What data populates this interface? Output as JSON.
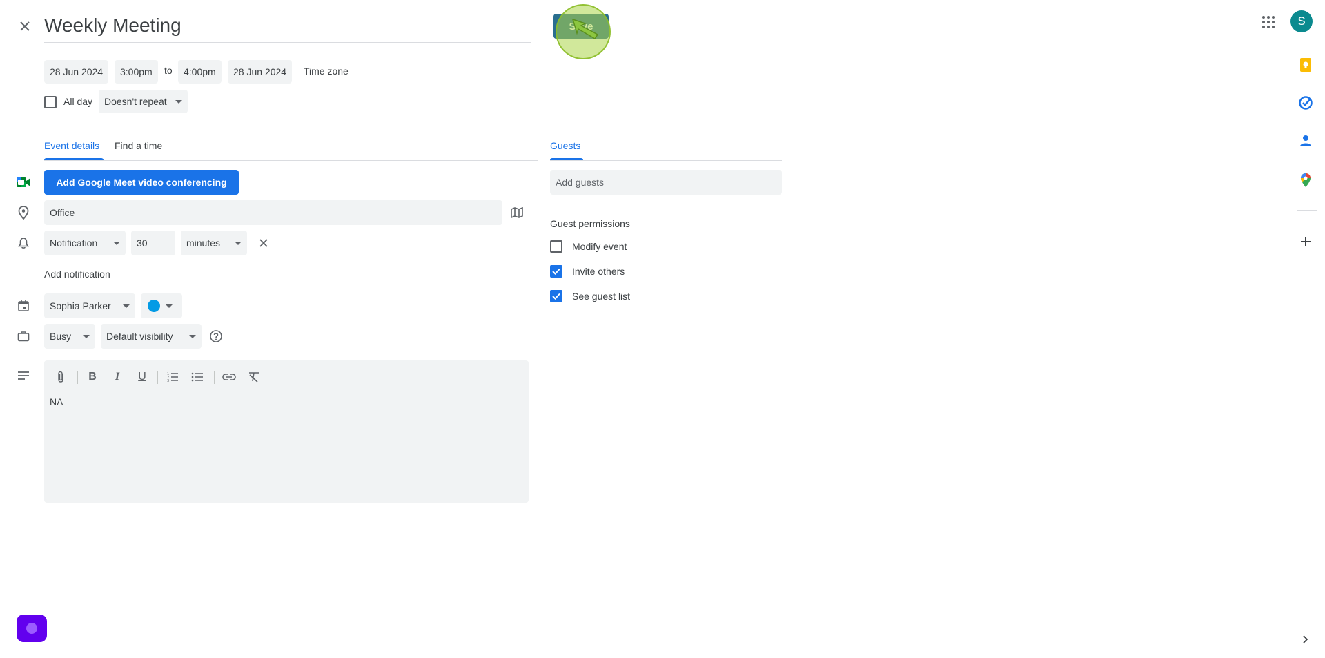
{
  "header": {
    "title_value": "Weekly Meeting",
    "save_label": "Save",
    "avatar_initial": "S"
  },
  "datetime": {
    "start_date": "28 Jun 2024",
    "start_time": "3:00pm",
    "to_label": "to",
    "end_time": "4:00pm",
    "end_date": "28 Jun 2024",
    "timezone_label": "Time zone",
    "all_day_label": "All day",
    "repeat_value": "Doesn't repeat"
  },
  "tabs": {
    "event_details": "Event details",
    "find_a_time": "Find a time",
    "guests": "Guests"
  },
  "details": {
    "meet_button": "Add Google Meet video conferencing",
    "location_value": "Office",
    "notification_type": "Notification",
    "notification_amount": "30",
    "notification_unit": "minutes",
    "add_notification": "Add notification",
    "calendar_owner": "Sophia Parker",
    "calendar_color": "#039be5",
    "availability": "Busy",
    "visibility": "Default visibility",
    "description": "NA"
  },
  "guests": {
    "placeholder": "Add guests",
    "permissions_title": "Guest permissions",
    "permissions": [
      {
        "label": "Modify event",
        "checked": false
      },
      {
        "label": "Invite others",
        "checked": true
      },
      {
        "label": "See guest list",
        "checked": true
      }
    ]
  },
  "colors": {
    "accent": "#1a73e8",
    "save_button": "#2a6e8f",
    "avatar": "#0b8a8f",
    "keep": "#fbbc04",
    "tasks": "#1a73e8",
    "contacts": "#1a73e8",
    "floating_button": "#6200ee"
  },
  "icons": {
    "close": "close-icon",
    "apps": "apps-grid-icon",
    "meet": "google-meet-icon",
    "location": "location-pin-icon",
    "bell": "bell-icon",
    "map": "map-icon",
    "calendar": "calendar-icon",
    "briefcase": "briefcase-icon",
    "description": "notes-icon",
    "help": "help-circle-icon",
    "keep": "keep-icon",
    "tasks": "tasks-icon",
    "contacts": "contacts-icon",
    "maps": "maps-icon",
    "add": "plus-icon",
    "expand": "chevron-right-icon"
  }
}
